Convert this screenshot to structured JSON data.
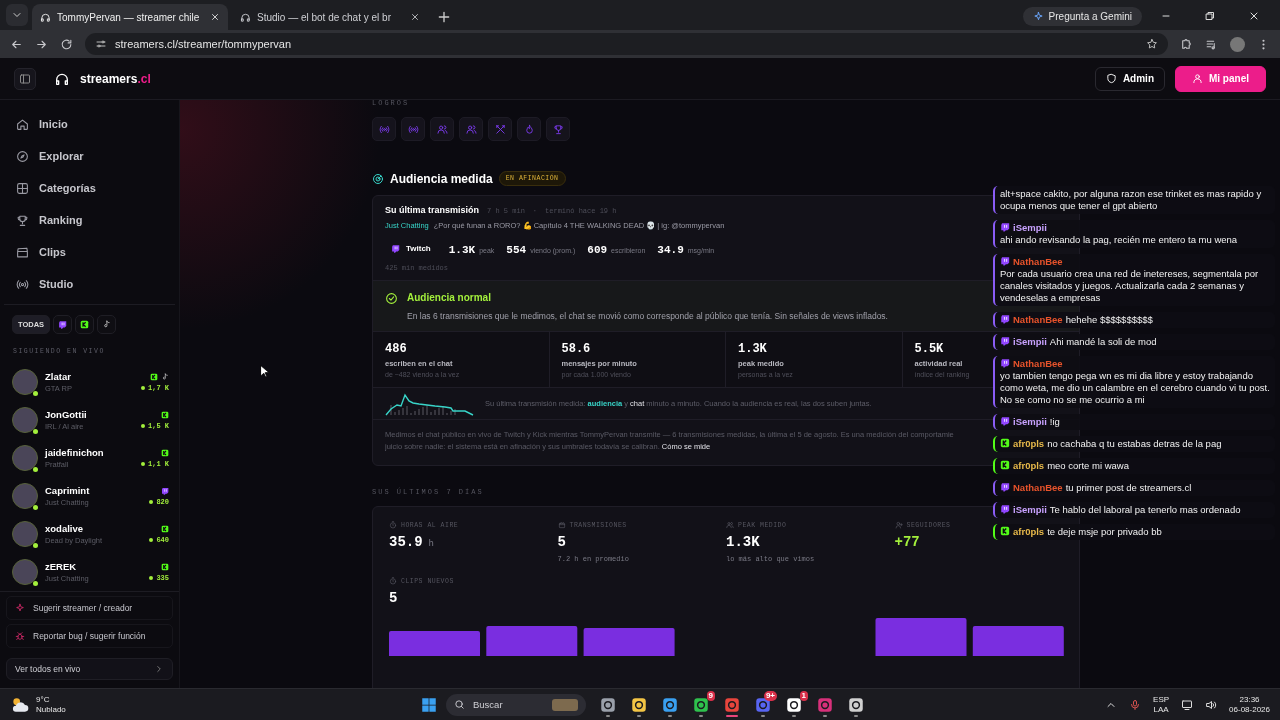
{
  "browser": {
    "tabs": [
      {
        "title": "TommyPervan — streamer chile",
        "selected": true
      },
      {
        "title": "Studio — el bot de chat y el br",
        "selected": false
      }
    ],
    "gemini": "Pregunta a Gemini",
    "url": "streamers.cl/streamer/tommypervan"
  },
  "header": {
    "logo": "streamers",
    "logo_suffix": ".cl",
    "buttons": [
      {
        "label": "Admin",
        "kind": "outline"
      },
      {
        "label": "Mi panel",
        "kind": "primary"
      }
    ]
  },
  "sidebar": {
    "nav": [
      {
        "label": "Inicio"
      },
      {
        "label": "Explorar"
      },
      {
        "label": "Categorías"
      },
      {
        "label": "Ranking"
      },
      {
        "label": "Clips"
      },
      {
        "label": "Studio"
      }
    ],
    "filters": [
      {
        "kind": "text",
        "label": "TODAS",
        "selected": true
      },
      {
        "kind": "twitch",
        "selected": false
      },
      {
        "kind": "kick",
        "selected": false
      },
      {
        "kind": "tiktok",
        "selected": false
      }
    ],
    "section": "SIGUIENDO EN VIVO",
    "streamers": [
      {
        "name": "Zlatar",
        "category": "GTA RP",
        "platforms": [
          {
            "kind": "kick"
          },
          {
            "kind": "tiktok"
          }
        ],
        "viewers": "1,7 K"
      },
      {
        "name": "JonGottii",
        "category": "IRL / Al aire",
        "platforms": [
          {
            "kind": "kick"
          }
        ],
        "viewers": "1,5 K"
      },
      {
        "name": "jaidefinichon",
        "category": "Pratfall",
        "platforms": [
          {
            "kind": "kick"
          }
        ],
        "viewers": "1,1 K"
      },
      {
        "name": "Caprimint",
        "category": "Just Chatting",
        "platforms": [
          {
            "kind": "twitch"
          }
        ],
        "viewers": "820"
      },
      {
        "name": "xodalive",
        "category": "Dead by Daylight",
        "platforms": [
          {
            "kind": "kick"
          }
        ],
        "viewers": "640"
      },
      {
        "name": "zEREK",
        "category": "Just Chatting",
        "platforms": [
          {
            "kind": "kick"
          }
        ],
        "viewers": "335"
      }
    ],
    "links": [
      {
        "label": "Sugerir streamer / creador"
      },
      {
        "label": "Reportar bug / sugerir función"
      }
    ],
    "all_live": "Ver todos en vivo"
  },
  "main": {
    "achievements_label": "LOGROS",
    "audience": {
      "title": "Audiencia medida",
      "badge": "EN AFINACIÓN",
      "last": {
        "label": "Su última transmisión",
        "duration": "7 h 5 min",
        "separator": "·",
        "ended": "terminó hace 19 h",
        "category": "Just Chatting",
        "stream_title": "¿Por qué funan a RORO? 💪 Capítulo 4 THE WALKING DEAD 💀 | ig: @tommypervan",
        "platform": "Twitch",
        "stats": [
          {
            "value": "1.3K",
            "unit": "peak"
          },
          {
            "value": "554",
            "unit": "viendo (prom.)"
          },
          {
            "value": "609",
            "unit": "escribieron"
          },
          {
            "value": "34.9",
            "unit": "msg/min"
          }
        ],
        "measured": "425 min medidos"
      },
      "verdict": {
        "title": "Audiencia normal",
        "text": "En las 6 transmisiones que le medimos, el chat se movió como corresponde al público que tenía. Sin señales de views inflados."
      },
      "metrics": [
        {
          "value": "486",
          "label": "escriben en el chat",
          "sub": "de ~482 viendo a la vez"
        },
        {
          "value": "58.6",
          "label": "mensajes por minuto",
          "sub": "por cada 1.000 viendo"
        },
        {
          "value": "1.3K",
          "label": "peak medido",
          "sub": "personas a la vez"
        },
        {
          "value": "5.5K",
          "label": "actividad real",
          "sub": "índice del ranking"
        }
      ],
      "sparkline_caption": "Su última transmisión medida: **audiencia** y **chat** minuto a minuto. Cuando la audiencia es real, las dos suben juntas.",
      "note_lines": [
        "Medimos el chat público en vivo de Twitch y Kick mientras TommyPervan transmite — 6 transmisiones medidas, la última el 5 de agosto. Es una medición del comportamie",
        "juicio sobre nadie: el sistema está en afinación y sus umbrales todavía se calibran."
      ],
      "note_link": "Cómo se mide"
    },
    "week": {
      "label": "SUS ÚLTIMOS 7 DÍAS",
      "stats": [
        {
          "label": "HORAS AL AIRE",
          "value": "35.9",
          "unit": "h",
          "positive": false
        },
        {
          "label": "TRANSMISIONES",
          "value": "5",
          "sub": "7.2 h en promedio",
          "positive": false
        },
        {
          "label": "PEAK MEDIDO",
          "value": "1.3K",
          "sub": "lo más alto que vimos",
          "positive": false
        },
        {
          "label": "SEGUIDORES",
          "value": "+77",
          "positive": true
        },
        {
          "label": "CLIPS NUEVOS",
          "value": "5",
          "positive": false
        }
      ]
    }
  },
  "chat": [
    {
      "kind": "continued",
      "platform": {
        "kind": "twitch"
      },
      "text": "alt+space cakito, por alguna razon ese trinket es mas rapido y ocupa menos que tener el gpt abierto"
    },
    {
      "kind": "block",
      "platform": {
        "kind": "twitch"
      },
      "user": "iSempii",
      "color": "#c8a2ff",
      "text": "ahi ando revisando la pag, recién me entero ta mu wena"
    },
    {
      "kind": "block",
      "platform": {
        "kind": "twitch"
      },
      "user": "NathanBee",
      "color": "#e8532b",
      "text": "Por cada usuario crea una red de inetereses, segmentala por canales visitados y juegos. Actualizarla cada 2 semanas y vendeselas a empresas"
    },
    {
      "kind": "inline",
      "platform": {
        "kind": "twitch"
      },
      "user": "NathanBee",
      "color": "#e8532b",
      "text": "hehehe $$$$$$$$$$"
    },
    {
      "kind": "inline",
      "platform": {
        "kind": "twitch"
      },
      "user": "iSempii",
      "color": "#c8a2ff",
      "text": "Ahi mandé la soli de mod"
    },
    {
      "kind": "block",
      "platform": {
        "kind": "twitch"
      },
      "user": "NathanBee",
      "color": "#e8532b",
      "text": "yo tambien tengo pega wn es mi dia libre y estoy trabajando como weta, me dio un calambre en el cerebro cuando vi tu post. No se como no se me ocurrio a mi"
    },
    {
      "kind": "inline",
      "platform": {
        "kind": "twitch"
      },
      "user": "iSempii",
      "color": "#c8a2ff",
      "text": "!ig"
    },
    {
      "kind": "inline",
      "platform": {
        "kind": "kick"
      },
      "user": "afr0pls",
      "color": "#e6b84a",
      "text": "no cachaba q tu estabas detras de la pag"
    },
    {
      "kind": "inline",
      "platform": {
        "kind": "kick"
      },
      "user": "afr0pls",
      "color": "#e6b84a",
      "text": "meo corte mi wawa"
    },
    {
      "kind": "inline",
      "platform": {
        "kind": "twitch"
      },
      "user": "NathanBee",
      "color": "#e8532b",
      "text": "tu primer post de streamers.cl"
    },
    {
      "kind": "inline",
      "platform": {
        "kind": "twitch"
      },
      "user": "iSempii",
      "color": "#c8a2ff",
      "text": "Te hablo del laboral pa tenerlo mas ordenado"
    },
    {
      "kind": "inline",
      "platform": {
        "kind": "kick"
      },
      "user": "afr0pls",
      "color": "#e6b84a",
      "text": "te deje msje por privado bb"
    }
  ],
  "taskbar": {
    "weather": {
      "temp": "9°C",
      "condition": "Nublado"
    },
    "search": "Buscar",
    "apps": [
      {
        "active": false
      },
      {
        "active": false
      },
      {
        "active": false
      },
      {
        "active": false,
        "badge": "9"
      },
      {
        "active": true
      },
      {
        "active": false,
        "badge": "9+"
      },
      {
        "active": false,
        "badge": "1"
      },
      {
        "active": false
      },
      {
        "active": false
      }
    ],
    "lang": "ESP",
    "layout": "LAA",
    "time": "23:36",
    "date": "06-08-2026"
  }
}
